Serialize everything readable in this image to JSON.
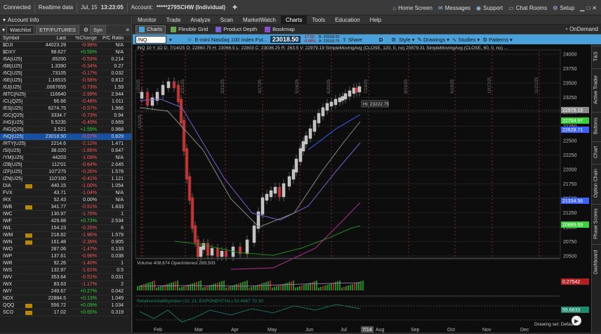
{
  "topbar": {
    "connected": "Connected",
    "realtime": "Realtime data",
    "date": "Jul, 15",
    "time": "13:23:05",
    "account_label": "Account:",
    "account_value": "*****279SCHW (Individual)",
    "home": "Home Screen",
    "messages": "Messages",
    "support": "Support",
    "chat": "Chat Rooms",
    "setup": "Setup"
  },
  "left": {
    "account_info": "Account Info",
    "tabs": [
      "Watchlist",
      "ETF/FUTURES",
      "Syn"
    ],
    "headers": {
      "symbol": "Symbol",
      "last": "Last",
      "chg": "%Change",
      "pc": "P/C Ratio"
    },
    "rows": [
      {
        "s": "$DJI",
        "l": "44023.29",
        "c": "-0.98%",
        "p": "N/A"
      },
      {
        "s": "$DXY",
        "l": "98.627",
        "c": "+0.56%",
        "p": "N/A"
      },
      {
        "s": "/6A[U25]",
        "l": ".65200",
        "c": "-0.53%",
        "p": "0.214"
      },
      {
        "s": "/6B[U25]",
        "l": "1.3390",
        "c": "-0.34%",
        "p": "0.27"
      },
      {
        "s": "/6C[U25]",
        "l": ".73105",
        "c": "-0.17%",
        "p": "0.032"
      },
      {
        "s": "/6E[U25]",
        "l": "1.16515",
        "c": "-0.58%",
        "p": "0.812"
      },
      {
        "s": "/6J[U25]",
        "l": ".0067655",
        "c": "-0.73%",
        "p": "1.59"
      },
      {
        "s": "/BTC[N25]",
        "l": "116640",
        "c": "-2.99%",
        "p": "2.944"
      },
      {
        "s": "/CL[Q25]",
        "l": "66.66",
        "c": "-0.48%",
        "p": "1.011"
      },
      {
        "s": "/ES[U25]",
        "l": "6274.75",
        "c": "-0.57%",
        "p": "1.966"
      },
      {
        "s": "/GC[Q25]",
        "l": "3334.7",
        "c": "-0.73%",
        "p": "0.94"
      },
      {
        "s": "/HG[U25]",
        "l": "5.5235",
        "c": "-0.49%",
        "p": "0.669"
      },
      {
        "s": "/NG[Q25]",
        "l": "3.521",
        "c": "+1.59%",
        "p": "0.968"
      },
      {
        "s": "/NQ[U25]",
        "l": "23018.50",
        "c": "-0.07%",
        "p": "0.829",
        "sel": true
      },
      {
        "s": "/RTY[U25]",
        "l": "2214.6",
        "c": "-2.12%",
        "p": "1.471"
      },
      {
        "s": "/SI[U25]",
        "l": "38.020",
        "c": "-1.86%",
        "p": "0.647"
      },
      {
        "s": "/YM[U25]",
        "l": "44203",
        "c": "-1.09%",
        "p": "N/A"
      },
      {
        "s": "/ZB[U25]",
        "l": "112'01",
        "c": "-0.64%",
        "p": "2.645"
      },
      {
        "s": "/ZF[U25]",
        "l": "107'275",
        "c": "-0.26%",
        "p": "1.578"
      },
      {
        "s": "/ZN[U25]",
        "l": "110'100",
        "c": "-0.41%",
        "p": "1.121"
      },
      {
        "s": "DIA",
        "l": "440.15",
        "c": "-1.00%",
        "p": "1.054",
        "b": true
      },
      {
        "s": "FVX",
        "l": "43.71",
        "c": "-1.04%",
        "p": "N/A"
      },
      {
        "s": "IRX",
        "l": "52.43",
        "c": "0.00%",
        "p": "N/A"
      },
      {
        "s": "IWB",
        "l": "341.77",
        "c": "-0.51%",
        "p": "1.833",
        "b": true
      },
      {
        "s": "IWC",
        "l": "130.97",
        "c": "-1.76%",
        "p": "1"
      },
      {
        "s": "IWF",
        "l": "429.88",
        "c": "+0.73%",
        "p": "2.534"
      },
      {
        "s": "IWL",
        "l": "154.23",
        "c": "-0.25%",
        "p": "6"
      },
      {
        "s": "IWM",
        "l": "218.82",
        "c": "-1.96%",
        "p": "1.579",
        "b": true
      },
      {
        "s": "IWN",
        "l": "161.48",
        "c": "-2.39%",
        "p": "0.905",
        "b": true
      },
      {
        "s": "IWO",
        "l": "287.06",
        "c": "-1.47%",
        "p": "0.133"
      },
      {
        "s": "IWP",
        "l": "137.61",
        "c": "-0.96%",
        "p": "0.038"
      },
      {
        "s": "IWR",
        "l": "92.26",
        "c": "-1.40%",
        "p": "1"
      },
      {
        "s": "IWS",
        "l": "132.97",
        "c": "-1.61%",
        "p": "0.5"
      },
      {
        "s": "IWV",
        "l": "353.64",
        "c": "-0.51%",
        "p": "0.031"
      },
      {
        "s": "IWX",
        "l": "83.63",
        "c": "-1.17%",
        "p": "2"
      },
      {
        "s": "IWY",
        "l": "249.67",
        "c": "+0.27%",
        "p": "0.042"
      },
      {
        "s": "NDX",
        "l": "22884.5",
        "c": "+0.13%",
        "p": "1.049"
      },
      {
        "s": "QQQ",
        "l": "556.72",
        "c": "+0.09%",
        "p": "1.034",
        "b": true
      },
      {
        "s": "SCO",
        "l": "17.02",
        "c": "+0.65%",
        "p": "0.319",
        "b": true
      }
    ]
  },
  "menu": [
    "Monitor",
    "Trade",
    "Analyze",
    "Scan",
    "MarketWatch",
    "Charts",
    "Tools",
    "Education",
    "Help"
  ],
  "subbar": [
    "Charts",
    "Flexible Grid",
    "Product Depth",
    "Bookmap"
  ],
  "ctool": {
    "symbol": "/NQ",
    "desc": "E-mini Nasdaq 100 Index Fut...",
    "price": "23018.50",
    "chg": "-17.50",
    "chg_pct": "-0.08%",
    "bid": "B: 23018.25",
    "ask": "A: 23018.75",
    "share": "Share",
    "style": "Style",
    "drawings": "Drawings",
    "studies": "Studies",
    "patterns": "Patterns",
    "d": "D",
    "ondemand": "OnDemand",
    "r1": "R1"
  },
  "chart": {
    "info": "/NQ 10 Y 1D  D: 7/14/25  O: 22860.75  H: 23066.5  L: 22803  C: 23036.25  R: 263.5  V: 22979.19  SimpleMovingAvg (CLOSE, 120, 0, no)  20879.31  SimpleMovingAvg (CLOSE, 60, 0, no) ...",
    "hi": "Hi: 23222.75",
    "yticks": [
      "24000",
      "23750",
      "23500",
      "23250",
      "23000",
      "22750",
      "22500",
      "22250",
      "22000",
      "21750",
      "21500",
      "21250",
      "21000",
      "20750",
      "20500"
    ],
    "price_tags": [
      {
        "v": "22979.19",
        "c": "#8a8a8a"
      },
      {
        "v": "22794.97",
        "c": "#3ccf3c"
      },
      {
        "v": "22628.71",
        "c": "#3a60ff"
      },
      {
        "v": "21334.56",
        "c": "#3a60ff"
      },
      {
        "v": "20889.69",
        "c": "#3ccf3c"
      }
    ],
    "vert_labels": [
      "1/20/25",
      "1/10/25",
      "2/21/25",
      "3/21/25",
      "4/17/25",
      "5/16/25",
      "6/20/25",
      "7/18/25",
      "8/15/25",
      "9/19/25",
      "10/17/25",
      "11/21/25"
    ],
    "months": [
      "Feb",
      "Mar",
      "Apr",
      "May",
      "Jun",
      "Jul",
      "Aug",
      "Sep",
      "Oct",
      "Nov",
      "Dec"
    ],
    "cur_date": "7/14",
    "volume": "Volume  408,674  OpenInterest  269,503",
    "vol_tag": "0.27542",
    "rvi": "RelativeVolatilityIndex (10, 21, EXPONENTIAL)  53.4987  70  30",
    "rvi_tag": "55.6833",
    "drawing_set": "Drawing set: Default"
  },
  "side_tabs": [
    "T&S",
    "Active Trader",
    "Buttons",
    "Chart",
    "Option Chain",
    "Phase Scores",
    "Dashboard"
  ]
}
